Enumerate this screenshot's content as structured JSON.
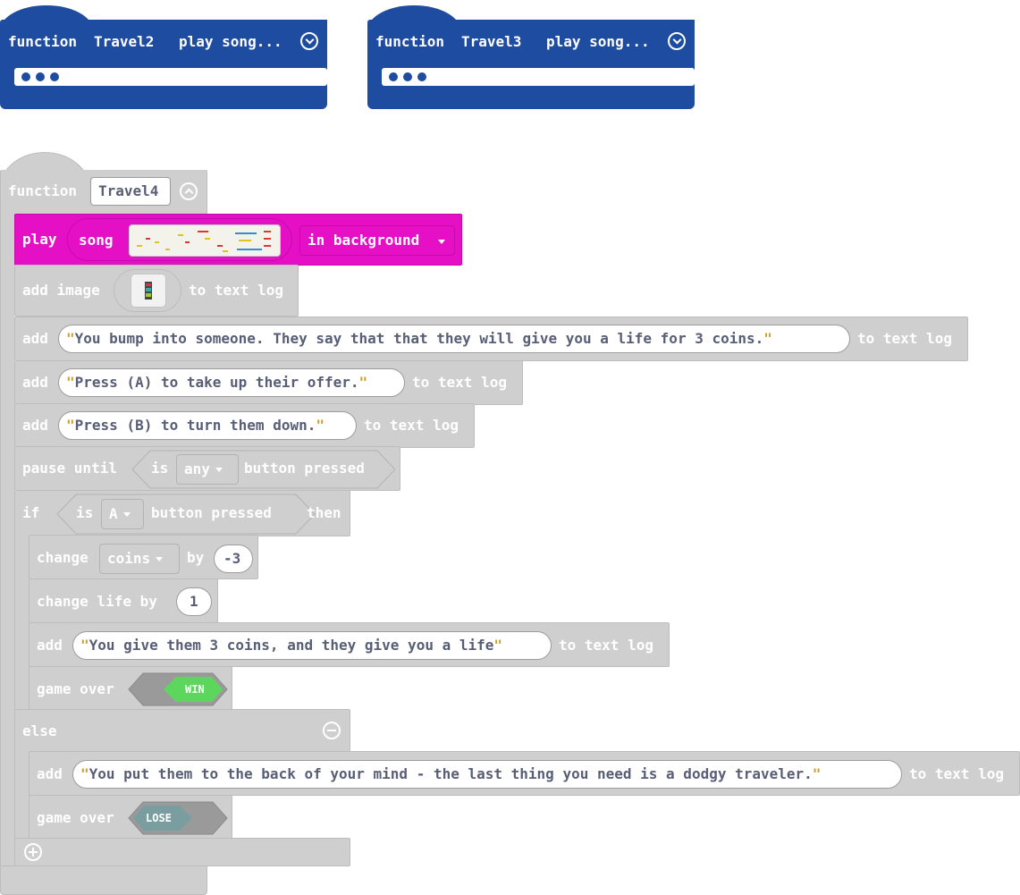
{
  "travel2": {
    "keyword": "function",
    "name": "Travel2",
    "summary": "play song..."
  },
  "travel3": {
    "keyword": "function",
    "name": "Travel3",
    "summary": "play song..."
  },
  "travel4": {
    "keyword": "function",
    "name": "Travel4",
    "play": {
      "play": "play",
      "song": "song",
      "mode": "in background"
    },
    "add_image": {
      "add": "add image",
      "suffix": "to text log"
    },
    "add_text_1": {
      "add": "add",
      "text": "You bump into someone. They say that that they will give you a life for 3 coins.",
      "suffix": "to text log"
    },
    "add_text_2": {
      "add": "add",
      "text": "Press (A) to take up their offer.",
      "suffix": "to text log"
    },
    "add_text_3": {
      "add": "add",
      "text": "Press (B) to turn them down.",
      "suffix": "to text log"
    },
    "pause": {
      "label": "pause until",
      "is": "is",
      "button": "any",
      "pressed": "button pressed"
    },
    "if_block": {
      "if": "if",
      "is": "is",
      "button": "A",
      "pressed": "button pressed",
      "then": "then"
    },
    "change_coins": {
      "change": "change",
      "var": "coins",
      "by": "by",
      "value": "-3"
    },
    "change_life": {
      "label": "change life by",
      "value": "1"
    },
    "add_text_4": {
      "add": "add",
      "text": "You give them 3 coins, and they give you a life",
      "suffix": "to text log"
    },
    "game_over_win": {
      "label": "game over",
      "value": "WIN"
    },
    "else": "else",
    "add_text_5": {
      "add": "add",
      "text": "You put them to the back of your mind - the last thing you need is a dodgy traveler.",
      "suffix": "to text log"
    },
    "game_over_lose": {
      "label": "game over",
      "value": "LOSE"
    }
  },
  "colors": {
    "function_blue": "#1e4ca1",
    "music_magenta": "#e510c6",
    "disabled_gray": "#cfcfcf",
    "win_green": "#5cd65c",
    "lose_gray": "#7a9e9f"
  },
  "icons": [
    "chevron-down-icon",
    "chevron-up-icon",
    "plus-icon",
    "minus-icon"
  ]
}
